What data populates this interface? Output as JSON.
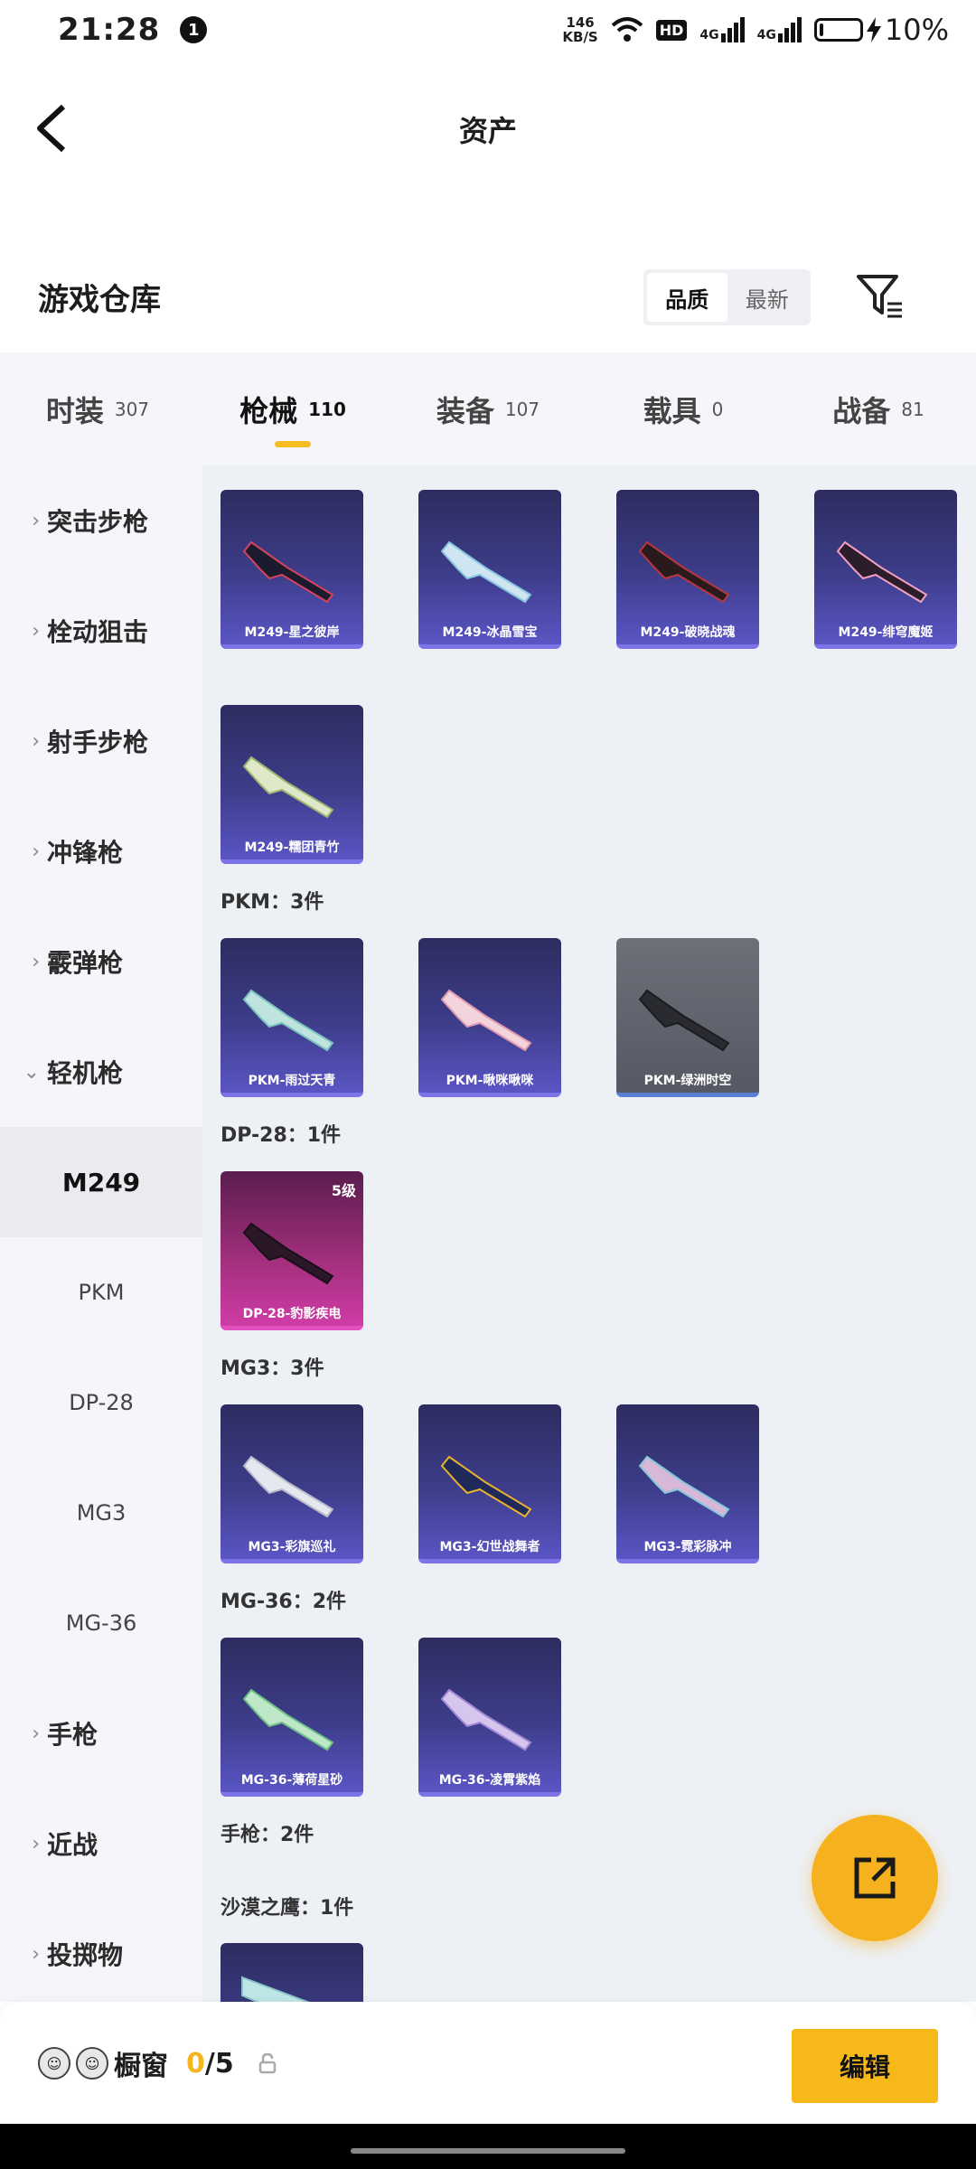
{
  "status_bar": {
    "time": "21:28",
    "notification_count": "1",
    "net_speed_value": "146",
    "net_speed_unit": "KB/S",
    "hd_label": "HD",
    "signal1": "4G",
    "signal2": "4G",
    "battery_percent": "10%",
    "battery_level": 0.1
  },
  "header": {
    "title": "资产"
  },
  "warehouse": {
    "title": "游戏仓库",
    "sort_options": [
      "品质",
      "最新"
    ],
    "selected_sort": "品质"
  },
  "tabs": [
    {
      "label": "时装",
      "count": "307"
    },
    {
      "label": "枪械",
      "count": "110",
      "active": true
    },
    {
      "label": "装备",
      "count": "107"
    },
    {
      "label": "载具",
      "count": "0"
    },
    {
      "label": "战备",
      "count": "81"
    }
  ],
  "sidebar": {
    "categories": [
      "突击步枪",
      "栓动狙击",
      "射手步枪",
      "冲锋枪",
      "霰弹枪",
      "轻机枪"
    ],
    "subitems": [
      "M249",
      "PKM",
      "DP-28",
      "MG3",
      "MG-36"
    ],
    "selected_subitem": "M249",
    "more_categories": [
      "手枪",
      "近战",
      "投掷物"
    ]
  },
  "items": {
    "m249": [
      "M249-星之彼岸",
      "M249-冰晶雪宝",
      "M249-破晓战魂",
      "M249-绯穹魔姬",
      "M249-糯团青竹"
    ],
    "pkm_header": "PKM：3件",
    "pkm": [
      "PKM-雨过天青",
      "PKM-啾咪啾咪",
      "PKM-绿洲时空"
    ],
    "dp28_header": "DP-28：1件",
    "dp28": [
      "DP-28-豹影疾电"
    ],
    "dp28_level": "5级",
    "mg3_header": "MG3：3件",
    "mg3": [
      "MG3-彩旗巡礼",
      "MG3-幻世战舞者",
      "MG3-霓彩脉冲"
    ],
    "mg36_header": "MG-36：2件",
    "mg36": [
      "MG-36-薄荷星砂",
      "MG-36-凌霄紫焰"
    ],
    "pistol_header": "手枪：2件",
    "deagle_header": "沙漠之鹰：1件"
  },
  "bottom_bar": {
    "shop_label": "橱窗",
    "count_current": "0",
    "count_sep_total": "/5",
    "edit_label": "编辑"
  },
  "colors": {
    "accent": "#f5bd22",
    "card_blue": "#3d3d8a",
    "card_purple": "#a5307f",
    "card_gray": "#6d6f79"
  },
  "icons": [
    "back-arrow-icon",
    "filter-icon",
    "export-icon",
    "lock-icon",
    "chevron-right-icon",
    "chevron-down-icon"
  ]
}
